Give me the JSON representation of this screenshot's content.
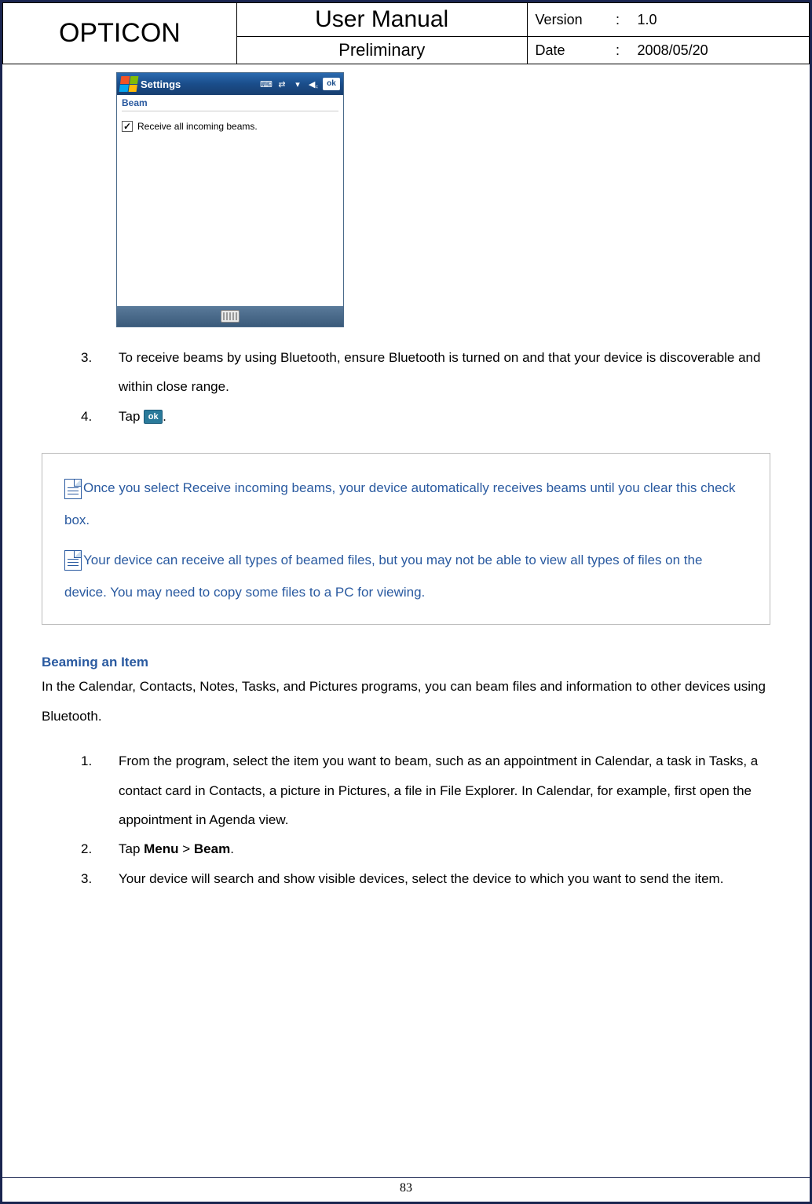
{
  "header": {
    "brand": "OPTICON",
    "title": "User Manual",
    "subtitle": "Preliminary",
    "meta": {
      "version_label": "Version",
      "version_value": "1.0",
      "date_label": "Date",
      "date_value": "2008/05/20",
      "colon": ":"
    }
  },
  "screenshot": {
    "title": "Settings",
    "ok": "ok",
    "tab": "Beam",
    "checkbox_checked": true,
    "checkbox_label": "Receive all incoming beams.",
    "tray": {
      "keyboard": "⌨",
      "net": "⇄",
      "signal": "▾",
      "volume": "🔈"
    }
  },
  "list_top": [
    {
      "n": "3.",
      "text": "To receive beams by using Bluetooth, ensure Bluetooth is turned on and that your device is discoverable and within close range."
    },
    {
      "n": "4.",
      "prefix": "Tap ",
      "ok": "ok",
      "suffix": "."
    }
  ],
  "notes": [
    "Once you select Receive incoming beams, your device automatically receives beams until you clear this check box.",
    "Your device can receive all types of beamed files, but you may not be able to view all types of files on the device. You may need to copy some files to a PC for viewing."
  ],
  "section_heading": "Beaming an Item",
  "section_intro": "In the Calendar, Contacts, Notes, Tasks, and Pictures programs, you can beam files and information to other devices using Bluetooth.",
  "list_bottom": [
    {
      "n": "1.",
      "text": "From the program, select the item you want to beam, such as an appointment in Calendar, a task in Tasks, a contact card in Contacts, a picture in Pictures, a file in File Explorer. In Calendar, for example, first open the appointment in Agenda view."
    },
    {
      "n": "2.",
      "prefix": "Tap ",
      "b1": "Menu",
      "mid": " > ",
      "b2": "Beam",
      "suffix": "."
    },
    {
      "n": "3.",
      "text": "Your device will search and show visible devices, select the device to which you want to send the item."
    }
  ],
  "page_number": "83"
}
